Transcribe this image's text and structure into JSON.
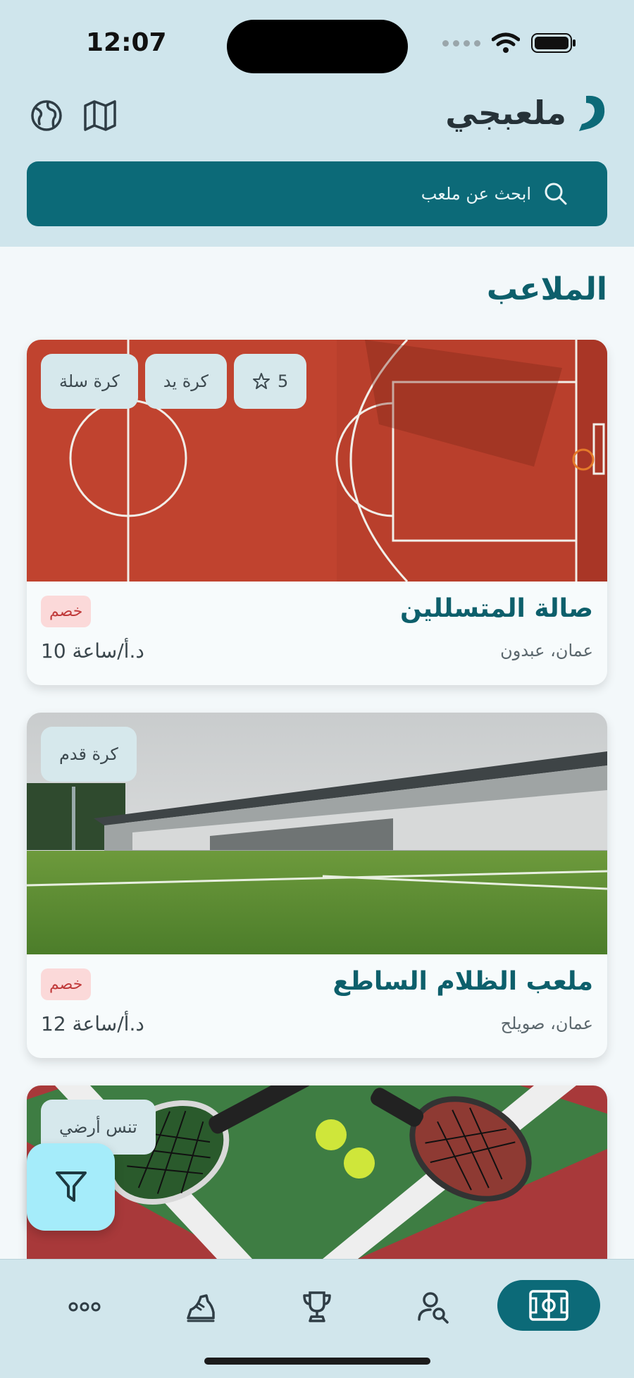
{
  "status": {
    "time": "12:07"
  },
  "header": {
    "brand_name": "ملعبجي",
    "icons": [
      "globe-icon",
      "map-icon"
    ]
  },
  "search": {
    "placeholder": "ابحث عن ملعب"
  },
  "section": {
    "title": "الملاعب"
  },
  "cards": [
    {
      "title": "صالة المتسللين",
      "location": "عمان، عبدون",
      "price": "10 د.أ/ساعة",
      "badge": "خصم",
      "chips": [
        "كرة سلة",
        "كرة يد"
      ],
      "rating": "5"
    },
    {
      "title": "ملعب الظلام الساطع",
      "location": "عمان، صويلح",
      "price": "12 د.أ/ساعة",
      "badge": "خصم",
      "chips": [
        "كرة قدم"
      ]
    },
    {
      "chips": [
        "تنس أرضي"
      ]
    }
  ],
  "colors": {
    "primary": "#0c6a78",
    "header_bg": "#cfe5ec",
    "fab": "#a5ecfa",
    "badge_bg": "#fbd9d9",
    "badge_text": "#c03a3a"
  },
  "bottom_nav": {
    "items": [
      "more-icon",
      "shoe-icon",
      "trophy-icon",
      "user-search-icon",
      "field-icon"
    ],
    "active": "field-icon"
  }
}
